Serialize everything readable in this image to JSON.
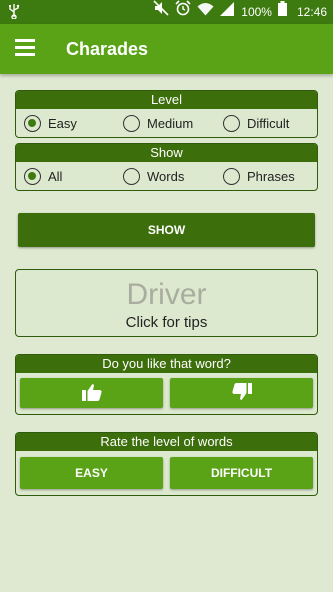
{
  "status_bar": {
    "usb_icon": "usb-icon",
    "mute_icon": "mute-icon",
    "alarm_icon": "alarm-icon",
    "wifi_icon": "wifi-icon",
    "signal_icon": "signal-icon",
    "battery_text": "100%",
    "battery_icon": "battery-icon",
    "time": "12:46"
  },
  "app_bar": {
    "title": "Charades",
    "menu_icon": "hamburger-menu-icon"
  },
  "level_panel": {
    "header": "Level",
    "options": [
      "Easy",
      "Medium",
      "Difficult"
    ],
    "selected": "Easy"
  },
  "show_panel": {
    "header": "Show",
    "options": [
      "All",
      "Words",
      "Phrases"
    ],
    "selected": "All"
  },
  "show_button": {
    "label": "SHOW"
  },
  "word_card": {
    "word": "Driver",
    "hint": "Click for tips"
  },
  "like_panel": {
    "header": "Do you like that word?",
    "like_icon": "thumbs-up-icon",
    "dislike_icon": "thumbs-down-icon"
  },
  "rate_panel": {
    "header": "Rate the level of words",
    "easy_label": "EASY",
    "difficult_label": "DIFFICULT"
  },
  "colors": {
    "status_bar": "#3d7a0f",
    "app_bar": "#5aa317",
    "panel_header": "#3d6e0c",
    "background": "#dfe9d2"
  }
}
